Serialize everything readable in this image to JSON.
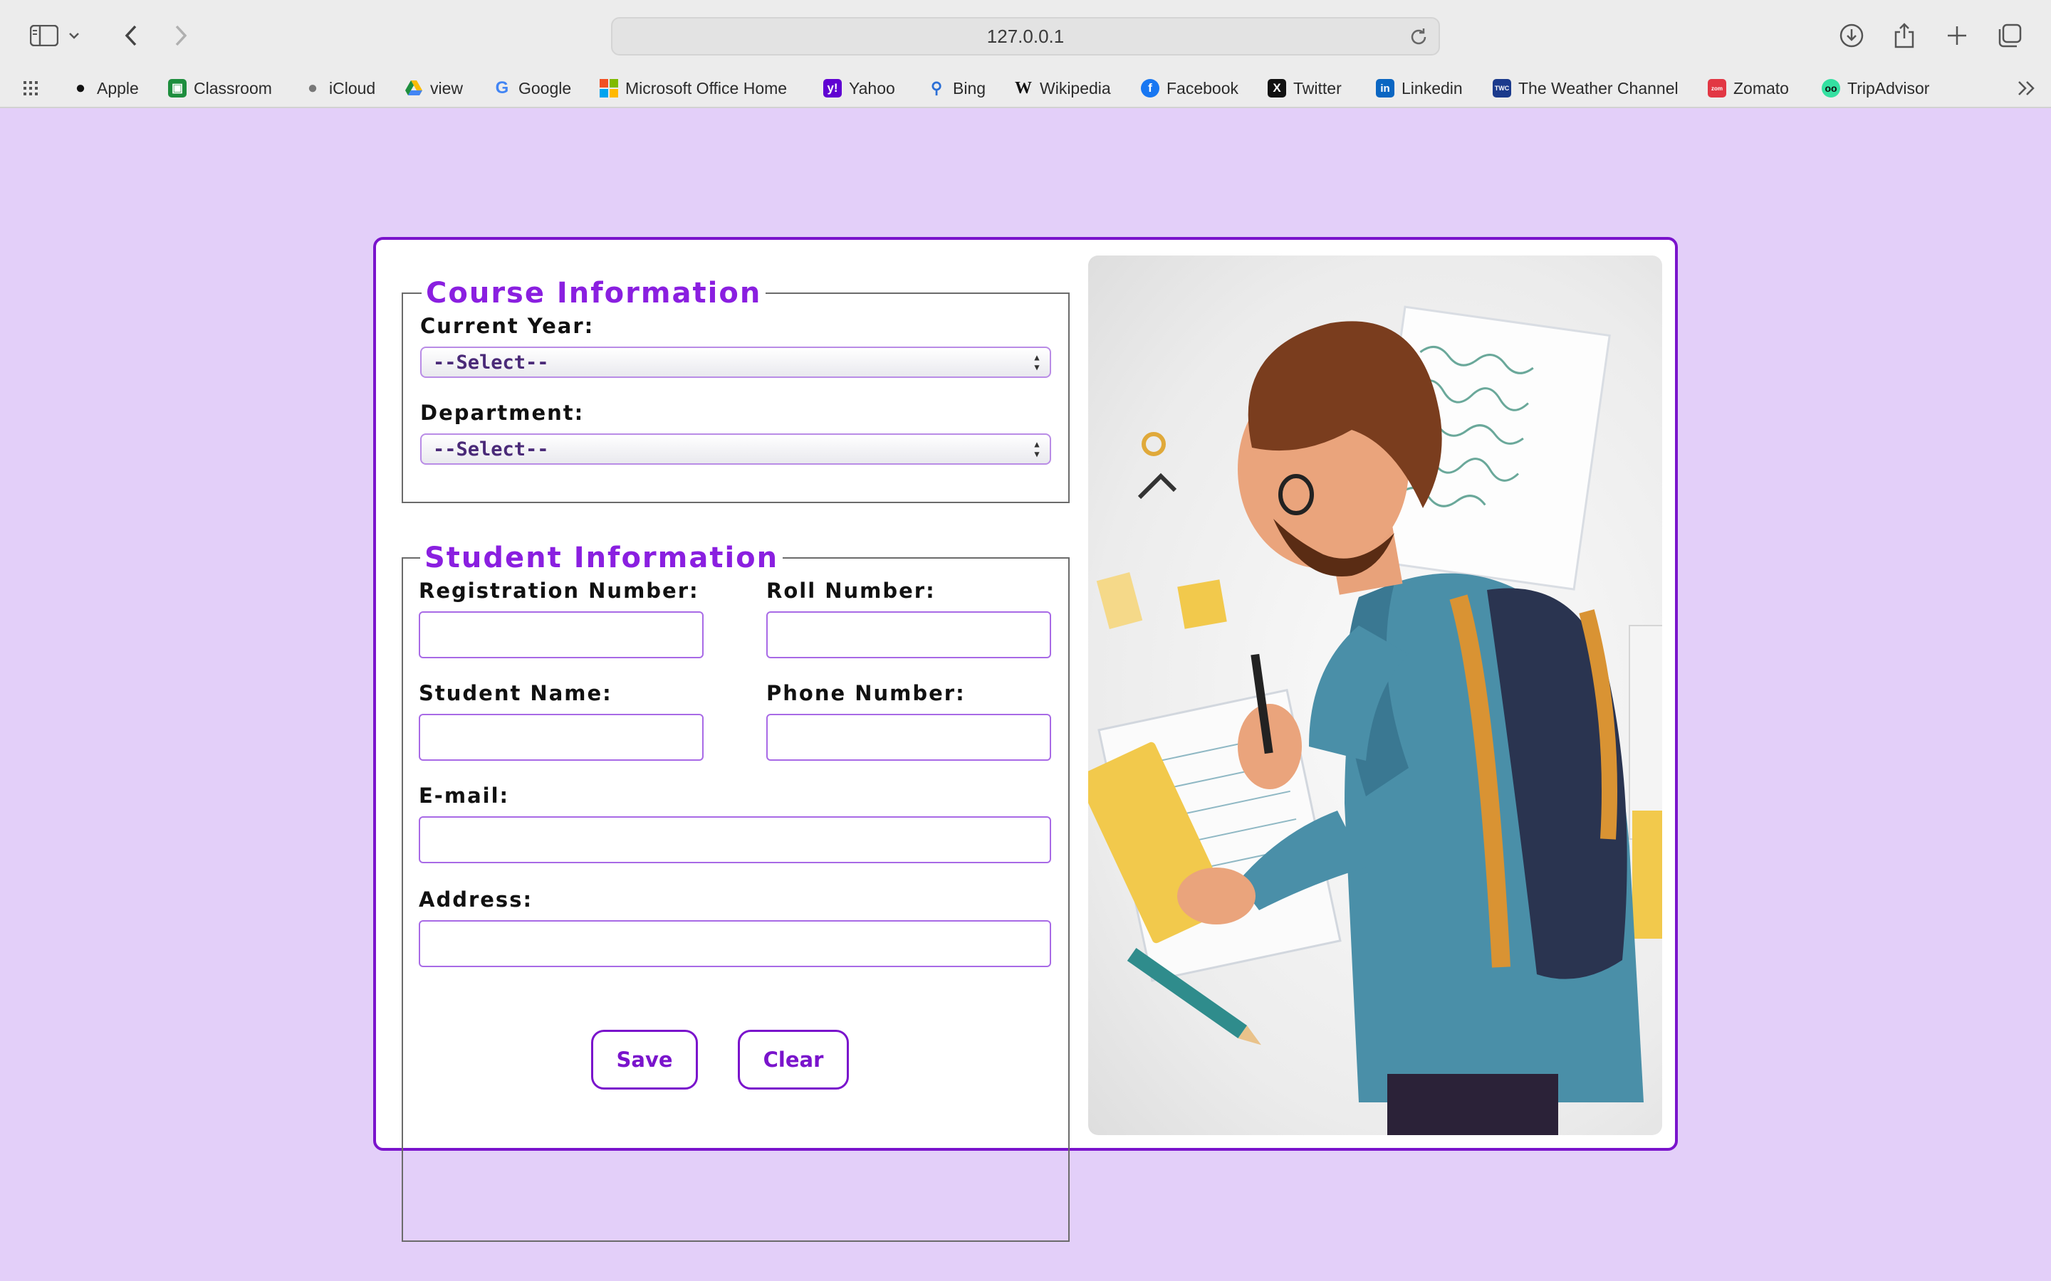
{
  "browser": {
    "url": "127.0.0.1",
    "bookmarks": [
      {
        "label": "Apple",
        "icon": "apple-icon"
      },
      {
        "label": "Classroom",
        "icon": "classroom-icon"
      },
      {
        "label": "iCloud",
        "icon": "icloud-icon"
      },
      {
        "label": "view",
        "icon": "drive-icon"
      },
      {
        "label": "Google",
        "icon": "google-icon"
      },
      {
        "label": "Microsoft Office Home",
        "icon": "microsoft-icon"
      },
      {
        "label": "Yahoo",
        "icon": "yahoo-icon"
      },
      {
        "label": "Bing",
        "icon": "bing-icon"
      },
      {
        "label": "Wikipedia",
        "icon": "wikipedia-icon"
      },
      {
        "label": "Facebook",
        "icon": "facebook-icon"
      },
      {
        "label": "Twitter",
        "icon": "twitter-icon"
      },
      {
        "label": "Linkedin",
        "icon": "linkedin-icon"
      },
      {
        "label": "The Weather Channel",
        "icon": "weather-channel-icon"
      },
      {
        "label": "Zomato",
        "icon": "zomato-icon"
      },
      {
        "label": "TripAdvisor",
        "icon": "tripadvisor-icon"
      }
    ]
  },
  "course": {
    "legend": "Course Information",
    "current_year_label": "Current Year:",
    "current_year_value": "--Select--",
    "department_label": "Department:",
    "department_value": "--Select--"
  },
  "student": {
    "legend": "Student Information",
    "registration_label": "Registration Number:",
    "roll_label": "Roll Number:",
    "name_label": "Student Name:",
    "phone_label": "Phone Number:",
    "email_label": "E-mail:",
    "address_label": "Address:"
  },
  "actions": {
    "save_label": "Save",
    "clear_label": "Clear"
  },
  "colors": {
    "page_background": "#e3cff9",
    "accent": "#7a14cc",
    "legend": "#8a1fe0"
  }
}
